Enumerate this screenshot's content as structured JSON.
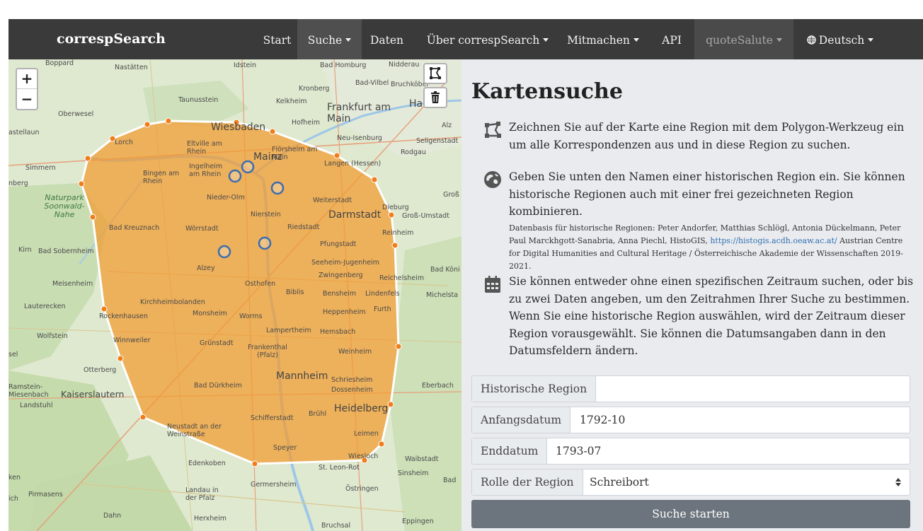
{
  "brand": "correspSearch",
  "nav": {
    "start": "Start",
    "suche": "Suche",
    "daten": "Daten",
    "ueber": "Über correspSearch",
    "mitmachen": "Mitmachen",
    "api": "API",
    "user": "quoteSalute",
    "language": "Deutsch"
  },
  "map": {
    "zoom_in": "+",
    "zoom_out": "−",
    "labels": {
      "boppard": "Boppard",
      "nastaetten": "Nastätten",
      "idstein": "Idstein",
      "bad_homburg": "Bad Homburg",
      "nidderau": "Nidderau",
      "kronberg": "Kronberg",
      "bad_vilbel": "Bad-Vilbel",
      "bruchkoebel": "Bruchköbel",
      "taunusstein": "Taunusstein",
      "kelkheim": "Kelkheim",
      "frankfurt": "Frankfurt am Main",
      "hanau": "Ha",
      "oberwesel": "Oberwesel",
      "hofheim": "Hofheim",
      "wiesbaden": "Wiesbaden",
      "neu_isenburg": "Neu-Isenburg",
      "seligenstadt": "Seligenstadt",
      "alz": "Alz",
      "astellaun": "astellaun",
      "lorch": "Lorch",
      "eltville": "Eltville am Rhein",
      "mainz": "Mainz",
      "floersheim": "Flörsheim am Main",
      "rodgau": "Rodgau",
      "simmern": "Simmern",
      "ingelheim": "Ingelheim am Rhein",
      "bingen": "Bingen am Rhein",
      "langen": "Langen (Hessen)",
      "nberg": "nberg",
      "naturpark": "Naturpark Soonwald-Nahe",
      "nieder_olm": "Nieder-Olm",
      "weiterstadt": "Weiterstadt",
      "dieburg": "Dieburg",
      "gross": "Groß",
      "nierstein": "Nierstein",
      "darmstadt": "Darmstadt",
      "gross_umstadt": "Groß-Umstadt",
      "bad_kreuznach": "Bad Kreuznach",
      "woerrstadt": "Wörrstadt",
      "riedstadt": "Riedstadt",
      "reinheim": "Reinheim",
      "kirn": "Kirn",
      "bad_sobernheim": "Bad Sobernheim",
      "pfungstadt": "Pfungstadt",
      "alzey": "Alzey",
      "seeheim": "Seeheim-Jugenheim",
      "zwingenberg": "Zwingenberg",
      "reichelsheim": "Reichelsheim",
      "bad_koenig": "Bad Köni",
      "meisenheim": "Meisenheim",
      "osthofen": "Osthofen",
      "biblis": "Biblis",
      "bensheim": "Bensheim",
      "lindenfels": "Lindenfels",
      "michelstadt": "Michelsta",
      "lauterecken": "Lauterecken",
      "kirchheimbolanden": "Kirchheimbolanden",
      "rockenhausen": "Rockenhausen",
      "monsheim": "Monsheim",
      "worms": "Worms",
      "heppenheim": "Heppenheim",
      "furth": "Furth",
      "wolfstein": "Wolfstein",
      "lampertheim": "Lampertheim",
      "hemsbach": "Hemsbach",
      "winnweiler": "Winnweiler",
      "gruenstadt": "Grünstadt",
      "frankenthal": "Frankenthal (Pfalz)",
      "weinheim": "Weinheim",
      "sel": "sel",
      "otterberg": "Otterberg",
      "mannheim": "Mannheim",
      "schriesheim": "Schriesheim",
      "dossenheim": "Dossenheim",
      "eberbach": "Eberbach",
      "ramstein": "Ramstein-Miesenbach",
      "kaiserslautern": "Kaiserslautern",
      "landstuhl": "Landstuhl",
      "bad_duerkheim": "Bad Dürkheim",
      "schifferstadt": "Schifferstadt",
      "bruehl": "Brühl",
      "heidelberg": "Heidelberg",
      "neustadt": "Neustadt an der Weinstraße",
      "leimen": "Leimen",
      "speyer": "Speyer",
      "wiesloch": "Wiesloch",
      "waibstadt": "Waibstadt",
      "edenkoben": "Edenkoben",
      "st_leon": "St. Leon-Rot",
      "sinsheim": "Sinsheim",
      "bad": "Bad",
      "ken": "ken",
      "germersheim": "Germersheim",
      "ostringen": "Östringen",
      "landau": "Landau in der Pfalz",
      "pirmasens": "Pirmasens",
      "dahn": "Dahn",
      "herxheim": "Herxheim",
      "bruchsal": "Bruchsal",
      "eppingen": "Eppingen",
      "ich": "ich"
    }
  },
  "panel": {
    "title": "Kartensuche",
    "info1": "Zeichnen Sie auf der Karte eine Region mit dem Polygon-Werkzeug ein um alle Korrespondenzen aus und in diese Region zu suchen.",
    "info2": "Geben Sie unten den Namen einer historischen Region ein. Sie können historische Regionen auch mit einer frei gezeichneten Region kombinieren.",
    "info2_small_prefix": "Datenbasis für historische Regionen: Peter Andorfer, Matthias Schlögl, Antonia Dückelmann, Peter Paul Marckhgott-Sanabria, Anna Piechl, HistoGIS, ",
    "info2_link": "https://histogis.acdh.oeaw.ac.at/",
    "info2_small_suffix": " Austrian Centre for Digital Humanities and Cultural Heritage / Österreichische Akademie der Wissenschaften 2019-2021.",
    "info3": "Sie können entweder ohne einen spezifischen Zeitraum suchen, oder bis zu zwei Daten angeben, um den Zeitrahmen Ihrer Suche zu bestimmen. Wenn Sie eine historische Region auswählen, wird der Zeitraum dieser Region vorausgewählt. Sie können die Datumsangaben dann in den Datumsfeldern ändern."
  },
  "form": {
    "region_label": "Historische Region",
    "region_value": "",
    "start_label": "Anfangsdatum",
    "start_value": "1792-10",
    "end_label": "Enddatum",
    "end_value": "1793-07",
    "role_label": "Rolle der Region",
    "role_value": "Schreibort",
    "submit": "Suche starten"
  },
  "colors": {
    "navbar": "#3a3a3a",
    "polygon_fill": "#f39a2e",
    "polygon_stroke": "#ffffff",
    "vertex": "#f07d1a",
    "link": "#2f6fb0",
    "button": "#6c757d"
  }
}
